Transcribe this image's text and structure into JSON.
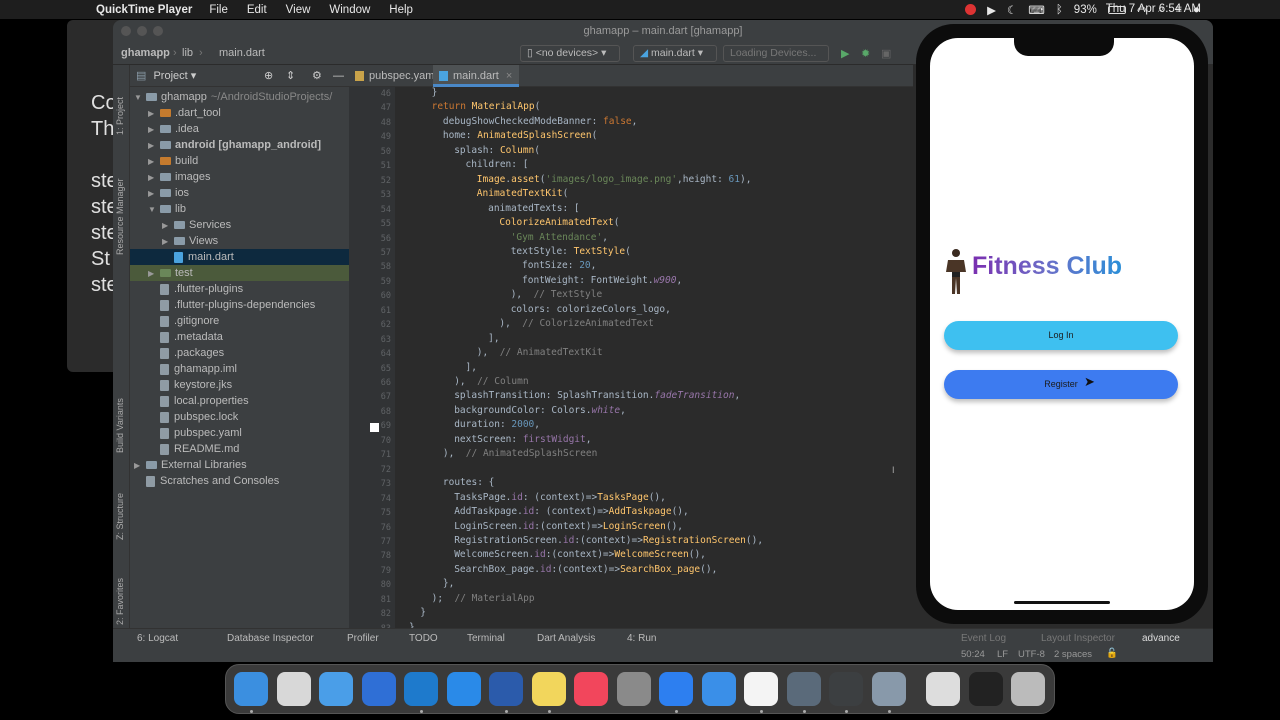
{
  "menubar": {
    "app_name": "QuickTime Player",
    "items": [
      "File",
      "Edit",
      "View",
      "Window",
      "Help"
    ],
    "battery": "93%",
    "datetime": "Thu 7 Apr  6:54 AM"
  },
  "background_window": {
    "lines": [
      "Co",
      "Th",
      "",
      "ste",
      "ste",
      "ste",
      "St",
      "ste"
    ]
  },
  "studio": {
    "title": "ghamapp – main.dart [ghamapp]",
    "breadcrumb": [
      "ghamapp",
      "lib",
      "main.dart"
    ],
    "device_select": "<no devices>",
    "run_config": "main.dart",
    "loading_devices": "Loading Devices...",
    "left_tabs": [
      "1: Project",
      "Resource Manager",
      "Build Variants",
      "Z: Structure",
      "2: Favorites"
    ],
    "project_panel": {
      "title": "Project",
      "tree": [
        {
          "label": "ghamapp",
          "suffix": "~/AndroidStudioProjects/",
          "indent": 0,
          "icon": "folder",
          "expanded": true
        },
        {
          "label": ".dart_tool",
          "indent": 1,
          "icon": "folder-orange",
          "arrow": true
        },
        {
          "label": ".idea",
          "indent": 1,
          "icon": "folder",
          "arrow": true
        },
        {
          "label": "android [ghamapp_android]",
          "indent": 1,
          "icon": "folder",
          "arrow": true,
          "bold": true
        },
        {
          "label": "build",
          "indent": 1,
          "icon": "folder-orange",
          "arrow": true
        },
        {
          "label": "images",
          "indent": 1,
          "icon": "folder",
          "arrow": true
        },
        {
          "label": "ios",
          "indent": 1,
          "icon": "folder",
          "arrow": true
        },
        {
          "label": "lib",
          "indent": 1,
          "icon": "folder",
          "expanded": true
        },
        {
          "label": "Services",
          "indent": 2,
          "icon": "folder",
          "arrow": true
        },
        {
          "label": "Views",
          "indent": 2,
          "icon": "folder",
          "arrow": true
        },
        {
          "label": "main.dart",
          "indent": 2,
          "icon": "file-blue",
          "selected": true
        },
        {
          "label": "test",
          "indent": 1,
          "icon": "folder-green",
          "arrow": true,
          "highlight": true
        },
        {
          "label": ".flutter-plugins",
          "indent": 1,
          "icon": "file"
        },
        {
          "label": ".flutter-plugins-dependencies",
          "indent": 1,
          "icon": "file"
        },
        {
          "label": ".gitignore",
          "indent": 1,
          "icon": "file"
        },
        {
          "label": ".metadata",
          "indent": 1,
          "icon": "file"
        },
        {
          "label": ".packages",
          "indent": 1,
          "icon": "file"
        },
        {
          "label": "ghamapp.iml",
          "indent": 1,
          "icon": "file"
        },
        {
          "label": "keystore.jks",
          "indent": 1,
          "icon": "file"
        },
        {
          "label": "local.properties",
          "indent": 1,
          "icon": "file"
        },
        {
          "label": "pubspec.lock",
          "indent": 1,
          "icon": "file"
        },
        {
          "label": "pubspec.yaml",
          "indent": 1,
          "icon": "file"
        },
        {
          "label": "README.md",
          "indent": 1,
          "icon": "file"
        },
        {
          "label": "External Libraries",
          "indent": 0,
          "icon": "folder",
          "arrow": true
        },
        {
          "label": "Scratches and Consoles",
          "indent": 0,
          "icon": "file"
        }
      ]
    },
    "editor_tabs": [
      "pubspec.yaml",
      "main.dart"
    ],
    "code_lines": [
      {
        "n": "46",
        "indent": 2,
        "html": "}"
      },
      {
        "n": "47",
        "indent": 2,
        "html": "<span class=\"kw\">return </span><span class=\"cls\">MaterialApp</span>("
      },
      {
        "n": "48",
        "indent": 3,
        "html": "debugShowCheckedModeBanner: <span class=\"kw\">false</span>,"
      },
      {
        "n": "49",
        "indent": 3,
        "html": "home: <span class=\"cls\">AnimatedSplashScreen</span>("
      },
      {
        "n": "50",
        "indent": 4,
        "html": "splash: <span class=\"cls\">Column</span>("
      },
      {
        "n": "51",
        "indent": 5,
        "html": "children: ["
      },
      {
        "n": "52",
        "indent": 6,
        "html": "<span class=\"cls\">Image</span>.<span class=\"cls\">asset</span>(<span class=\"str\">'images/logo_image.png'</span>,height: <span class=\"num\">61</span>),"
      },
      {
        "n": "53",
        "indent": 6,
        "html": "<span class=\"cls\">AnimatedTextKit</span>("
      },
      {
        "n": "54",
        "indent": 7,
        "html": "animatedTexts: ["
      },
      {
        "n": "55",
        "indent": 8,
        "html": "<span class=\"cls\">ColorizeAnimatedText</span>("
      },
      {
        "n": "56",
        "indent": 9,
        "html": "<span class=\"str\">'Gym Attendance'</span>,"
      },
      {
        "n": "57",
        "indent": 9,
        "html": "textStyle: <span class=\"cls\">TextStyle</span>("
      },
      {
        "n": "58",
        "indent": 10,
        "html": "fontSize: <span class=\"num\">20</span>,"
      },
      {
        "n": "59",
        "indent": 10,
        "html": "fontWeight: FontWeight.<span class=\"prop\"><i>w900</i></span>,"
      },
      {
        "n": "60",
        "indent": 9,
        "html": "),  <span class=\"cmt\">// TextStyle</span>"
      },
      {
        "n": "61",
        "indent": 9,
        "html": "colors: colorizeColors_logo,"
      },
      {
        "n": "62",
        "indent": 8,
        "html": "),  <span class=\"cmt\">// ColorizeAnimatedText</span>"
      },
      {
        "n": "63",
        "indent": 7,
        "html": "],"
      },
      {
        "n": "64",
        "indent": 6,
        "html": "),  <span class=\"cmt\">// AnimatedTextKit</span>"
      },
      {
        "n": "65",
        "indent": 5,
        "html": "],"
      },
      {
        "n": "66",
        "indent": 4,
        "html": "),  <span class=\"cmt\">// Column</span>"
      },
      {
        "n": "67",
        "indent": 4,
        "html": "splashTransition: SplashTransition.<span class=\"prop\"><i>fadeTransition</i></span>,"
      },
      {
        "n": "68",
        "indent": 4,
        "html": "backgroundColor: Colors.<span class=\"prop\"><i>white</i></span>,"
      },
      {
        "n": "69",
        "indent": 4,
        "html": "duration: <span class=\"num\">2000</span>,"
      },
      {
        "n": "70",
        "indent": 4,
        "html": "nextScreen: <span class=\"prop\">firstWidgit</span>,"
      },
      {
        "n": "71",
        "indent": 3,
        "html": "),  <span class=\"cmt\">// AnimatedSplashScreen</span>"
      },
      {
        "n": "72",
        "indent": 0,
        "html": ""
      },
      {
        "n": "73",
        "indent": 3,
        "html": "routes: {"
      },
      {
        "n": "74",
        "indent": 4,
        "html": "TasksPage.<span class=\"prop\">id</span>: (context)=&gt;<span class=\"cls\">TasksPage</span>(),"
      },
      {
        "n": "75",
        "indent": 4,
        "html": "AddTaskpage.<span class=\"prop\">id</span>: (context)=&gt;<span class=\"cls\">AddTaskpage</span>(),"
      },
      {
        "n": "76",
        "indent": 4,
        "html": "LoginScreen.<span class=\"prop\">id</span>:(context)=&gt;<span class=\"cls\">LoginScreen</span>(),"
      },
      {
        "n": "77",
        "indent": 4,
        "html": "RegistrationScreen.<span class=\"prop\">id</span>:(context)=&gt;<span class=\"cls\">RegistrationScreen</span>(),"
      },
      {
        "n": "78",
        "indent": 4,
        "html": "WelcomeScreen.<span class=\"prop\">id</span>:(context)=&gt;<span class=\"cls\">WelcomeScreen</span>(),"
      },
      {
        "n": "79",
        "indent": 4,
        "html": "SearchBox_page.<span class=\"prop\">id</span>:(context)=&gt;<span class=\"cls\">SearchBox_page</span>(),"
      },
      {
        "n": "80",
        "indent": 3,
        "html": "},"
      },
      {
        "n": "81",
        "indent": 2,
        "html": ");  <span class=\"cmt\">// MaterialApp</span>"
      },
      {
        "n": "82",
        "indent": 1,
        "html": "}"
      },
      {
        "n": "83",
        "indent": 0,
        "html": "}"
      }
    ],
    "bottom_tools": [
      "6: Logcat",
      "Database Inspector",
      "Profiler",
      "TODO",
      "Terminal",
      "Dart Analysis",
      "4: Run"
    ],
    "right_tools": [
      "Event Log",
      "Layout Inspector"
    ],
    "status": {
      "position": "50:24",
      "line_sep": "LF",
      "encoding": "UTF-8",
      "indent": "2 spaces"
    }
  },
  "phone": {
    "brand_title": "Fitness Club",
    "login_label": "Log In",
    "register_label": "Register",
    "colors": {
      "login": "#3ec0f0",
      "register": "#3d7bf0",
      "brand_start": "#7a2fb0",
      "brand_end": "#2b8fd8"
    }
  },
  "side_text": "advance",
  "dock": {
    "apps": [
      "finder-icon",
      "launchpad-icon",
      "mail-icon",
      "xcode-icon",
      "vscode-icon",
      "app-store-icon",
      "word-icon",
      "notes-icon",
      "music-icon",
      "system-preferences-icon",
      "app-store2-icon",
      "safari-icon",
      "generic-app-icon",
      "quicktime-icon",
      "android-studio-icon",
      "simulator-icon",
      "itunes-file-icon",
      "screen-icon",
      "trash-icon"
    ]
  }
}
